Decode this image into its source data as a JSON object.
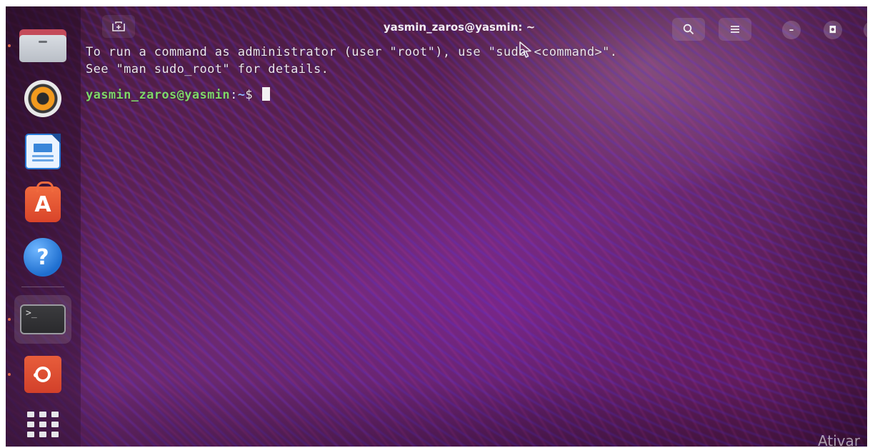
{
  "window": {
    "title": "yasmin_zaros@yasmin: ~",
    "new_tab_icon": "new-tab-icon",
    "buttons": {
      "search_icon": "search-icon",
      "menu_icon": "hamburger-menu-icon",
      "minimize_label": "–",
      "maximize_label": "◘",
      "close_label": "×"
    }
  },
  "terminal": {
    "lines": [
      "To run a command as administrator (user \"root\"), use \"sudo <command>\".",
      "See \"man sudo_root\" for details."
    ],
    "prompt": {
      "user_host": "yasmin_zaros@yasmin",
      "colon": ":",
      "path": "~",
      "symbol": "$ "
    }
  },
  "dock": {
    "items": [
      {
        "name": "Files",
        "icon": "folder-icon",
        "running": true
      },
      {
        "name": "Rhythmbox",
        "icon": "speaker-icon",
        "running": false
      },
      {
        "name": "LibreOffice Writer",
        "icon": "document-icon",
        "running": false
      },
      {
        "name": "Ubuntu Software",
        "icon": "store-bag-icon",
        "running": false
      },
      {
        "name": "Help",
        "icon": "help-icon",
        "running": false
      },
      {
        "name": "Terminal",
        "icon": "terminal-icon",
        "running": true
      },
      {
        "name": "Ubuntu",
        "icon": "ubuntu-logo-icon",
        "running": true
      },
      {
        "name": "Show Applications",
        "icon": "app-grid-icon",
        "running": false
      }
    ]
  },
  "overlay": {
    "watermark_text": "Ativar"
  },
  "colors": {
    "prompt_user": "#7fd86a",
    "prompt_path": "#8fb4ff",
    "text": "#eae6ec",
    "ubuntu_orange": "#e85d3b"
  }
}
